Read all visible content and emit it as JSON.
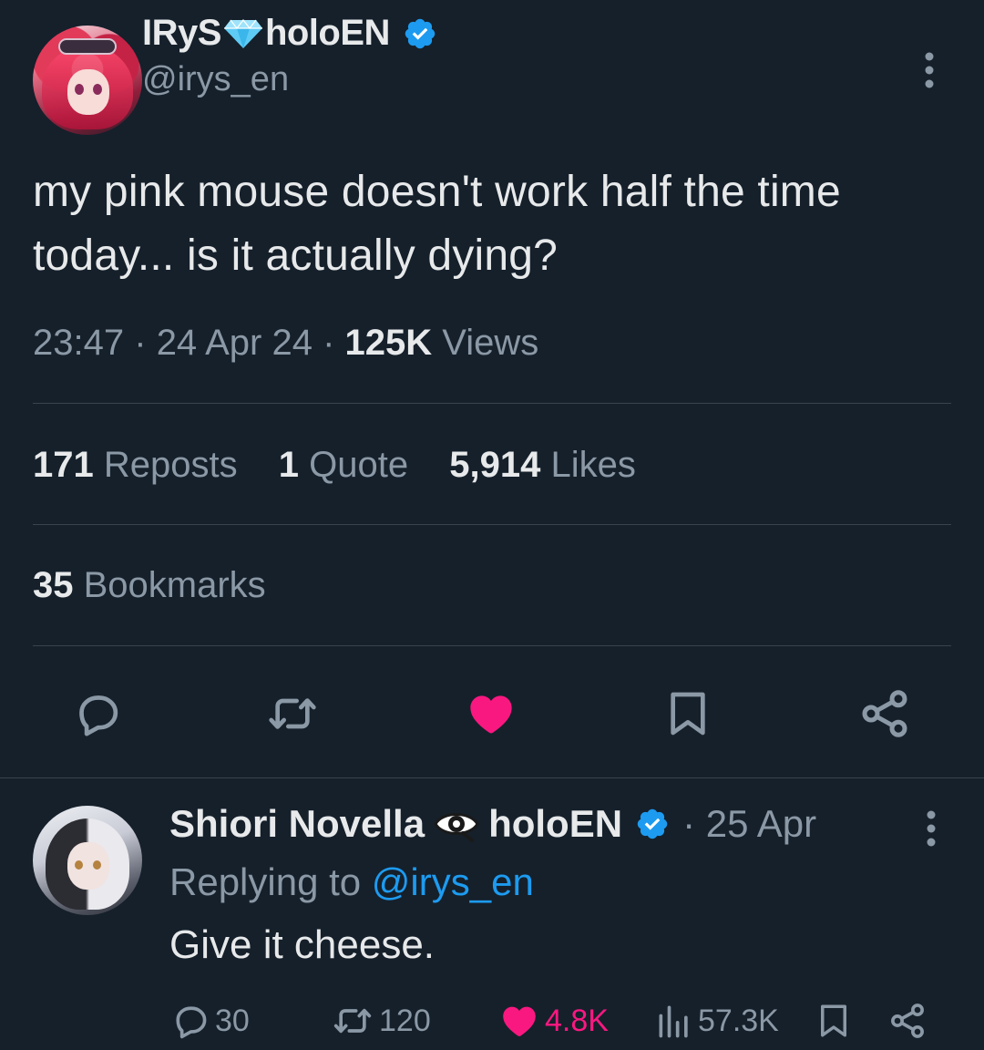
{
  "main_tweet": {
    "author": {
      "name_part1": "IRyS",
      "name_part2": "holoEN",
      "handle": "@irys_en"
    },
    "text": "my pink mouse doesn't work half the time today... is it actually dying?",
    "time": "23:47",
    "date": "24 Apr 24",
    "views_count": "125K",
    "views_label": "Views",
    "separator": "·",
    "stats": {
      "reposts_count": "171",
      "reposts_label": "Reposts",
      "quotes_count": "1",
      "quotes_label": "Quote",
      "likes_count": "5,914",
      "likes_label": "Likes",
      "bookmarks_count": "35",
      "bookmarks_label": "Bookmarks"
    },
    "liked": true
  },
  "reply": {
    "author": {
      "name": "Shiori Novella",
      "org": "holoEN"
    },
    "date": "· 25 Apr",
    "replying_prefix": "Replying to",
    "replying_handle": "@irys_en",
    "text": "Give it cheese.",
    "counts": {
      "replies": "30",
      "reposts": "120",
      "likes": "4.8K",
      "views": "57.3K"
    },
    "liked": true
  },
  "colors": {
    "background": "#15202b",
    "text_primary": "#e7e9ea",
    "text_secondary": "#8b98a5",
    "accent_blue": "#1d9bf0",
    "like_pink": "#f91880",
    "divider": "#38444d"
  },
  "icons": [
    "gem-icon",
    "verified-icon",
    "more-icon",
    "reply-icon",
    "repost-icon",
    "like-icon",
    "bookmark-icon",
    "share-icon",
    "eye-icon",
    "views-icon"
  ]
}
